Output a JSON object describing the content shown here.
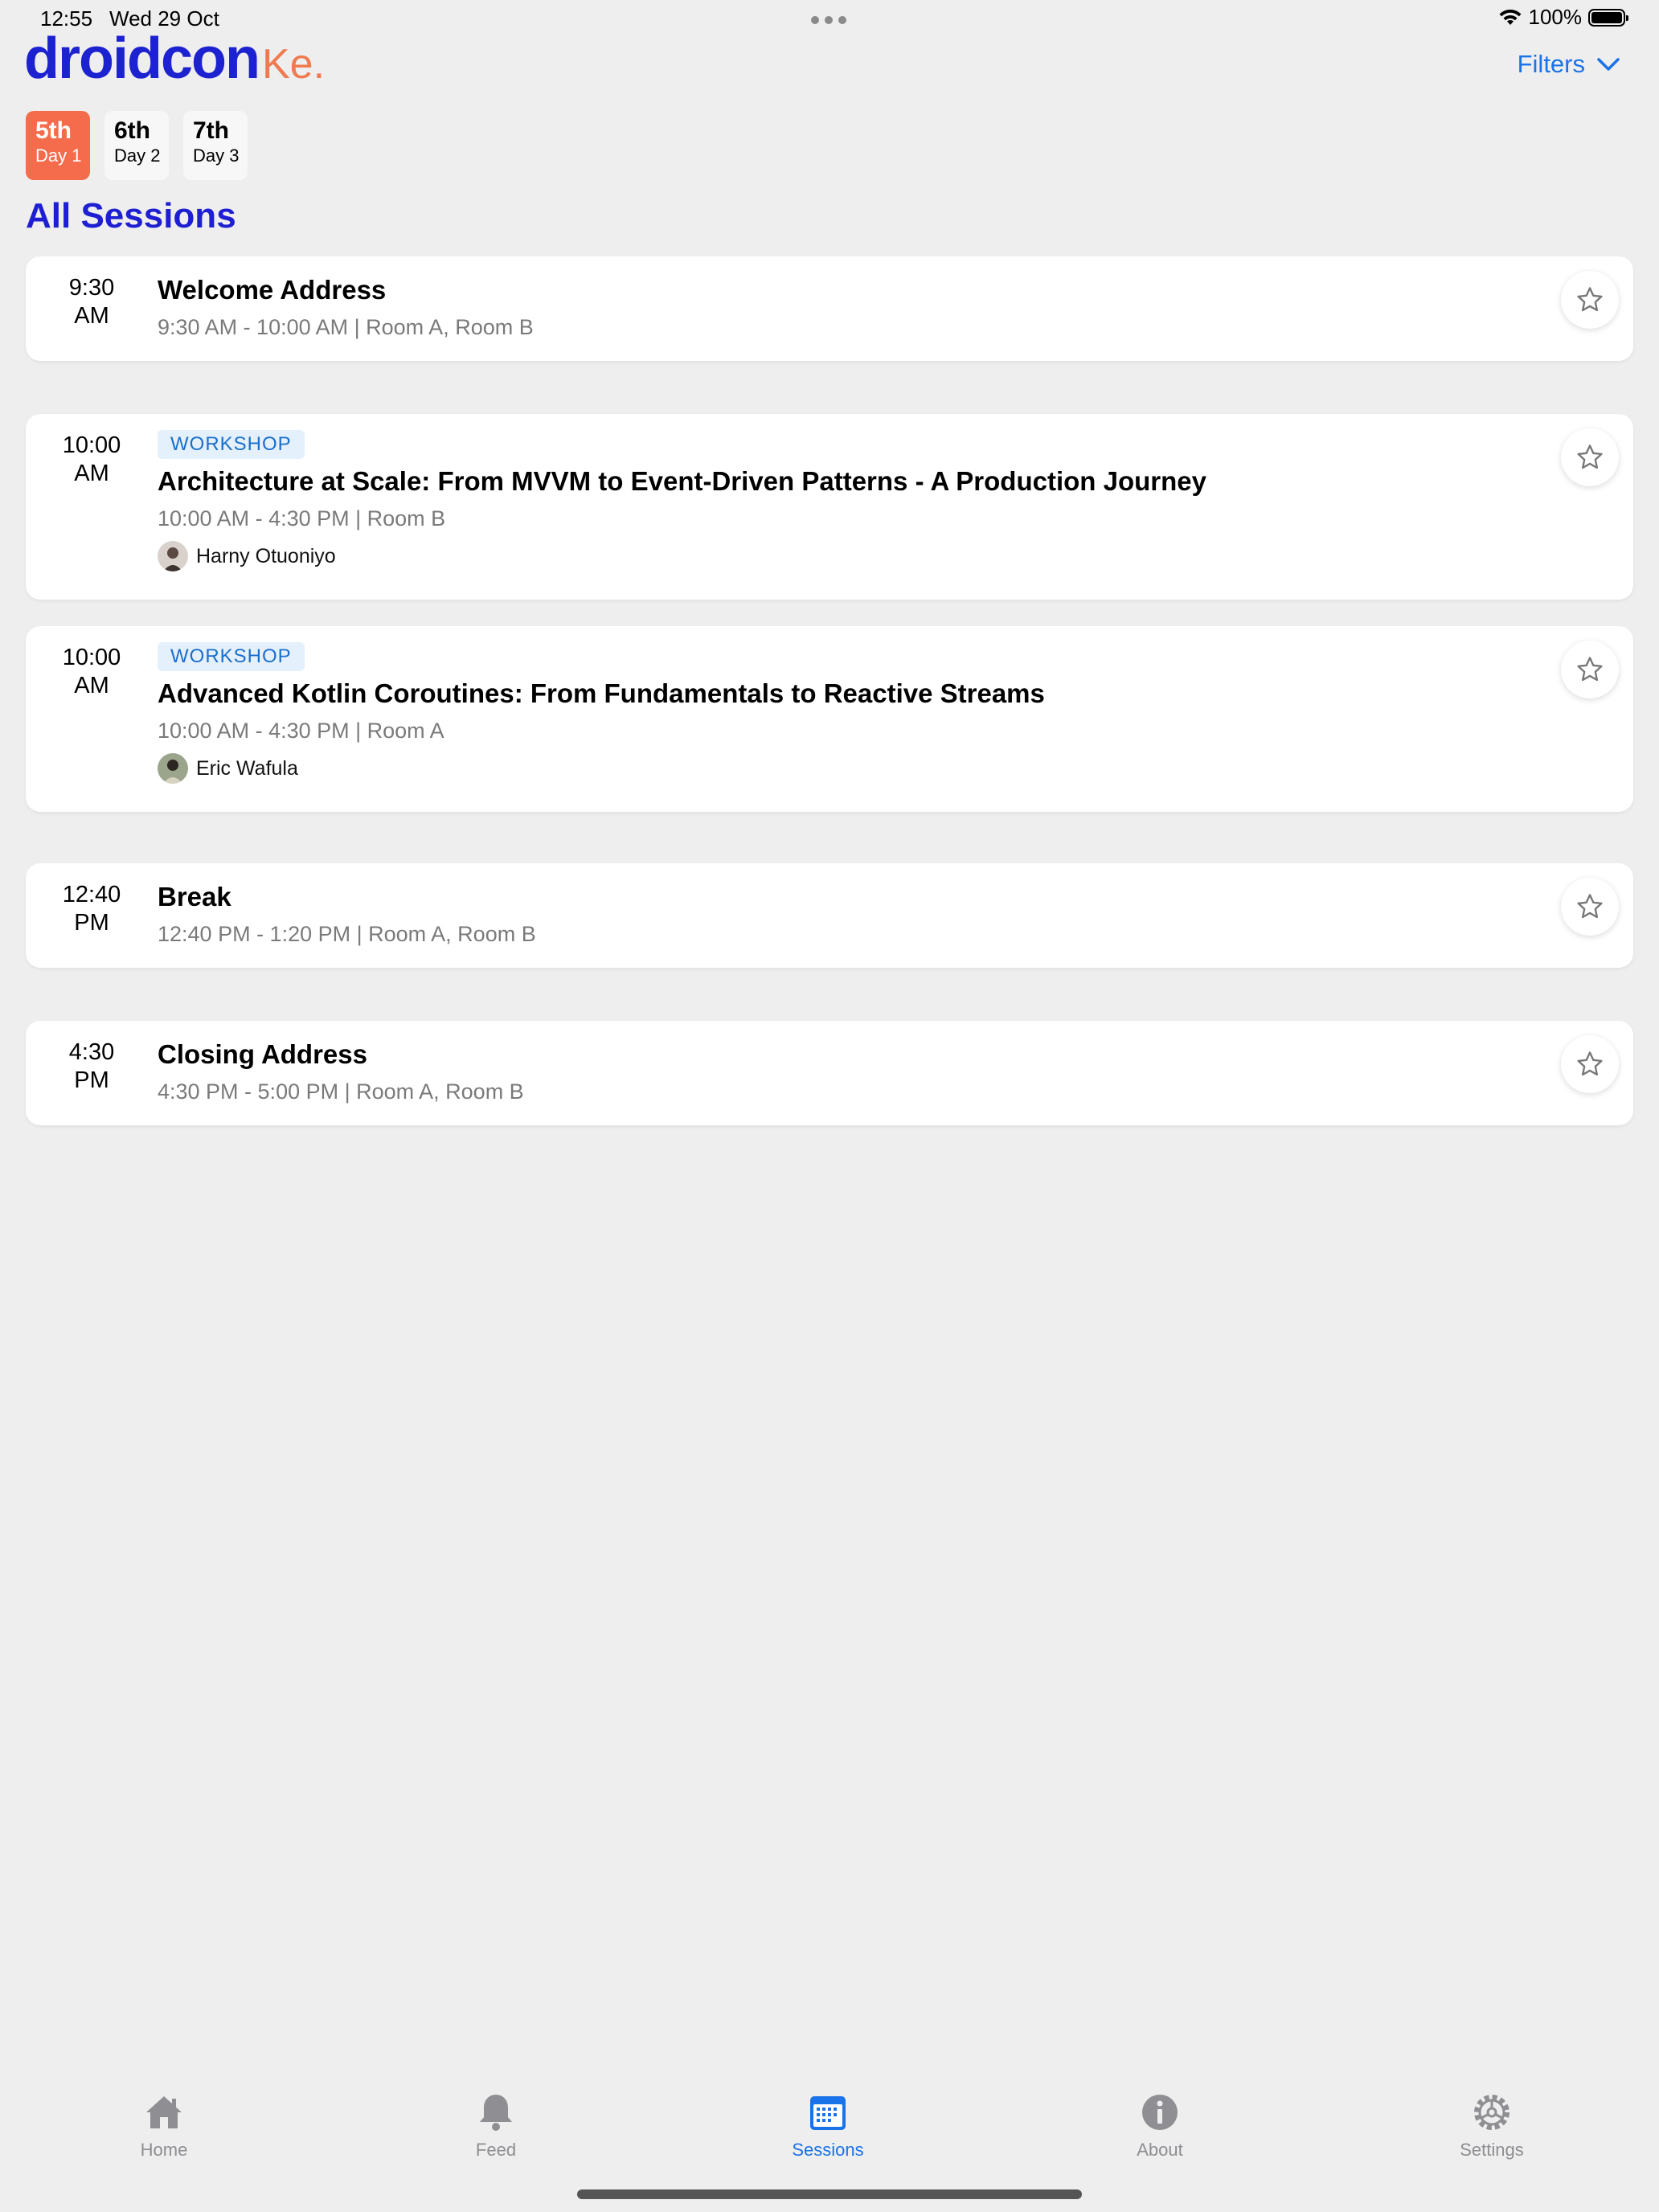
{
  "status_bar": {
    "time": "12:55",
    "date": "Wed 29 Oct",
    "battery": "100%"
  },
  "header": {
    "logo_main": "droidcon",
    "logo_suffix": "Ke.",
    "filters_label": "Filters"
  },
  "days": [
    {
      "num": "5th",
      "label": "Day 1",
      "active": true
    },
    {
      "num": "6th",
      "label": "Day 2",
      "active": false
    },
    {
      "num": "7th",
      "label": "Day 3",
      "active": false
    }
  ],
  "section_title": "All Sessions",
  "sessions": [
    {
      "time": "9:30",
      "ampm": "AM",
      "title": "Welcome Address",
      "meta": "9:30 AM - 10:00 AM | Room A, Room B"
    },
    {
      "time": "10:00",
      "ampm": "AM",
      "badge": "WORKSHOP",
      "title": "Architecture at Scale: From MVVM to Event-Driven Patterns - A Production Journey",
      "meta": "10:00 AM - 4:30 PM | Room B",
      "speaker": "Harny Otuoniyo"
    },
    {
      "time": "10:00",
      "ampm": "AM",
      "badge": "WORKSHOP",
      "title": "Advanced Kotlin Coroutines: From Fundamentals to Reactive Streams",
      "meta": "10:00 AM - 4:30 PM | Room A",
      "speaker": "Eric Wafula"
    },
    {
      "time": "12:40",
      "ampm": "PM",
      "title": "Break",
      "meta": "12:40 PM - 1:20 PM | Room A, Room B"
    },
    {
      "time": "4:30",
      "ampm": "PM",
      "title": "Closing Address",
      "meta": "4:30 PM - 5:00 PM | Room A, Room B"
    }
  ],
  "tabbar": [
    {
      "label": "Home",
      "icon": "home-icon"
    },
    {
      "label": "Feed",
      "icon": "bell-icon"
    },
    {
      "label": "Sessions",
      "icon": "calendar-icon",
      "active": true
    },
    {
      "label": "About",
      "icon": "info-icon"
    },
    {
      "label": "Settings",
      "icon": "gear-icon"
    }
  ],
  "colors": {
    "accent": "#1A73E8",
    "brand_blue": "#1E1FD2",
    "brand_orange": "#F56C4D",
    "background": "#EEEEEE"
  }
}
